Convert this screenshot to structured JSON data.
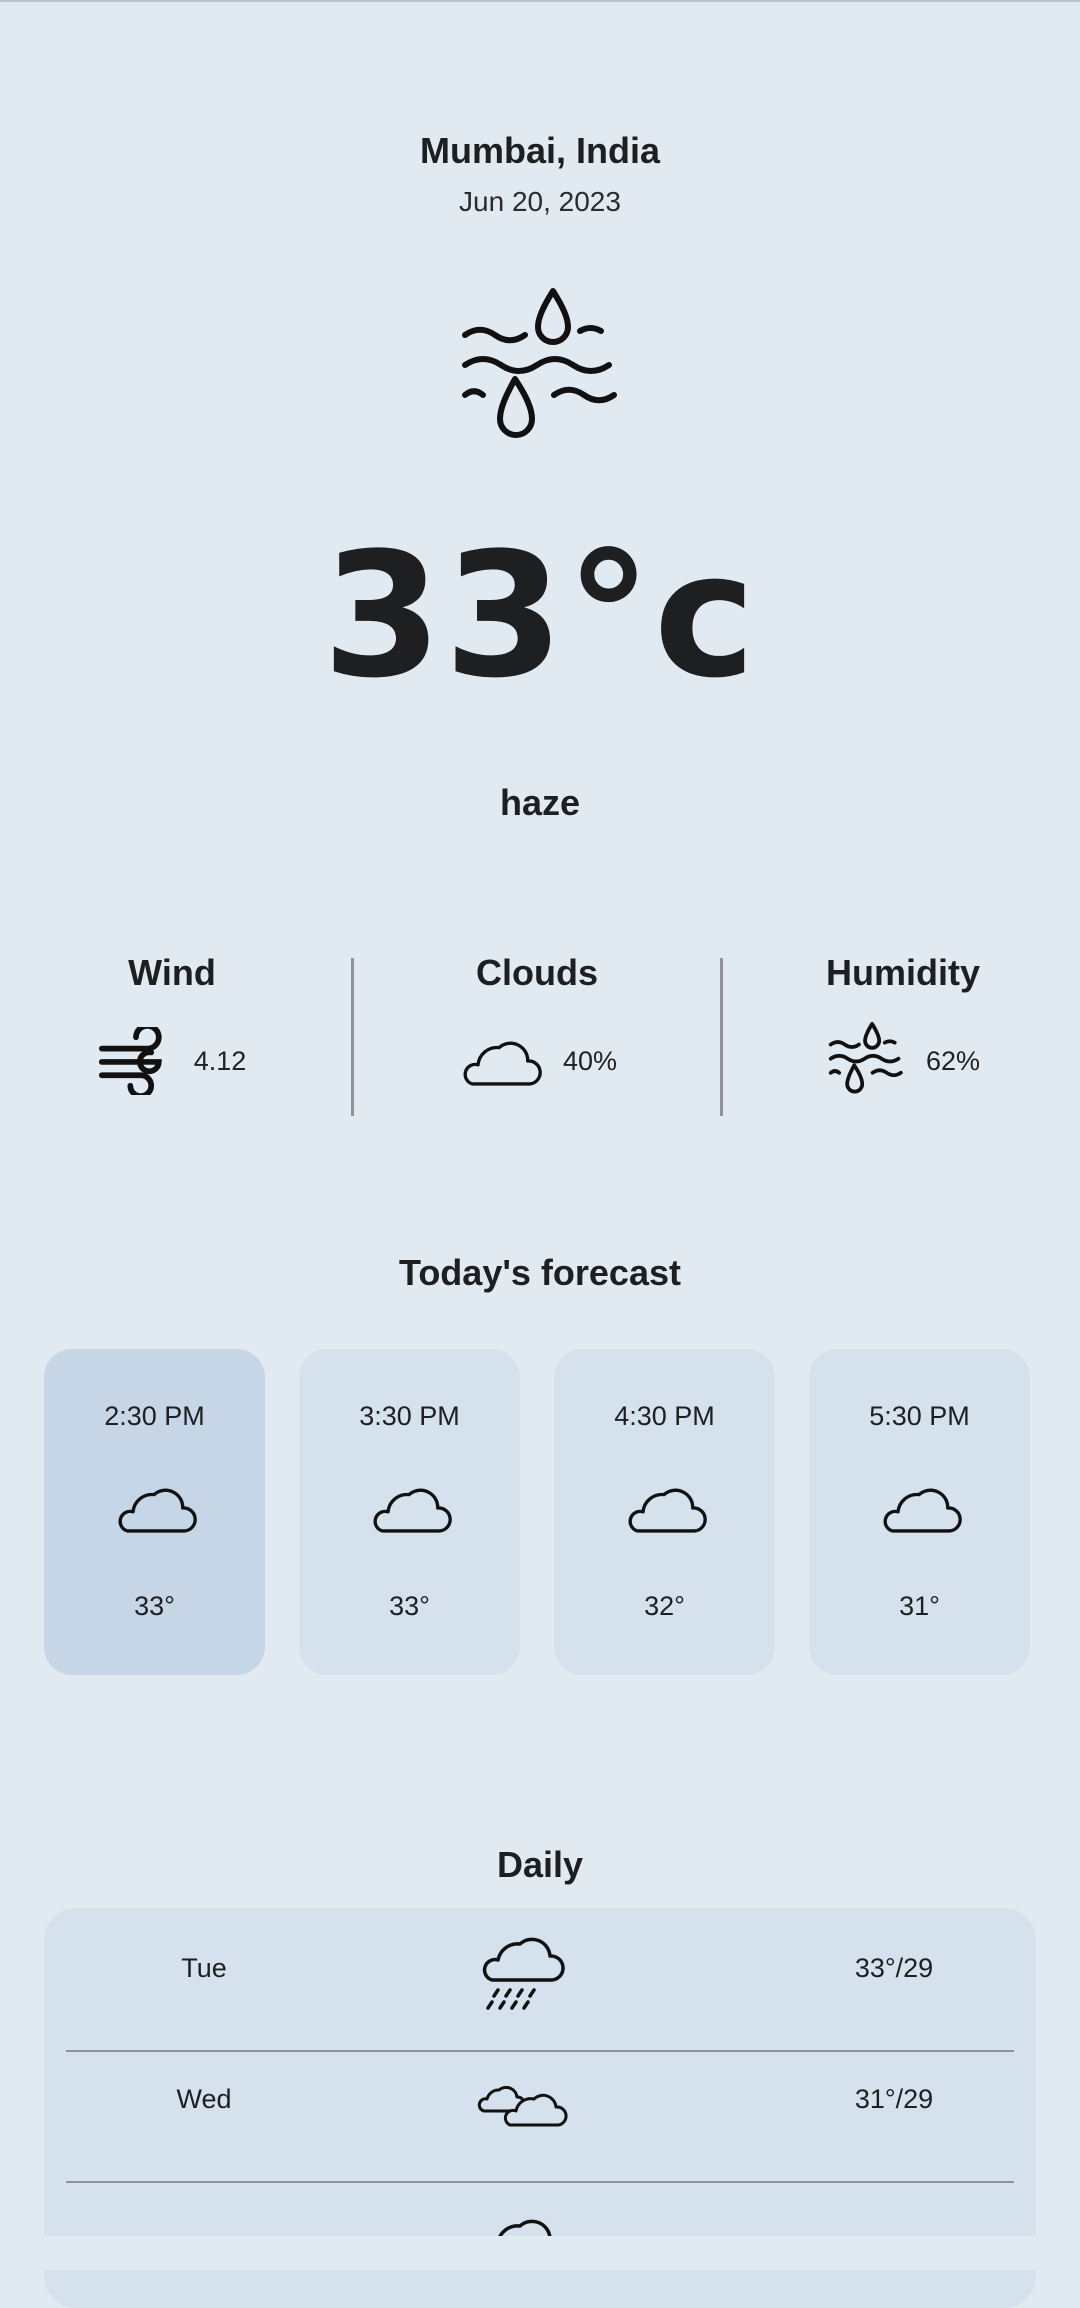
{
  "location": {
    "city": "Mumbai, India",
    "date": "Jun 20, 2023",
    "icon": "haze-icon"
  },
  "current": {
    "temperature": "33°c",
    "condition": "haze"
  },
  "stats": {
    "wind": {
      "title": "Wind",
      "value": "4.12",
      "icon": "wind-icon"
    },
    "clouds": {
      "title": "Clouds",
      "value": "40%",
      "icon": "cloud-icon"
    },
    "humidity": {
      "title": "Humidity",
      "value": "62%",
      "icon": "haze-icon"
    }
  },
  "forecast": {
    "title": "Today's forecast",
    "items": [
      {
        "time": "2:30 PM",
        "temp": "33°",
        "icon": "cloud-icon",
        "selected": true
      },
      {
        "time": "3:30 PM",
        "temp": "33°",
        "icon": "cloud-icon",
        "selected": false
      },
      {
        "time": "4:30 PM",
        "temp": "32°",
        "icon": "cloud-icon",
        "selected": false
      },
      {
        "time": "5:30 PM",
        "temp": "31°",
        "icon": "cloud-icon",
        "selected": false
      }
    ]
  },
  "daily": {
    "title": "Daily",
    "items": [
      {
        "day": "Tue",
        "temp": "33°/29",
        "icon": "rain-cloud-icon"
      },
      {
        "day": "Wed",
        "temp": "31°/29",
        "icon": "two-clouds-icon"
      },
      {
        "day": "",
        "temp": "",
        "icon": "cloud-icon"
      }
    ]
  },
  "colors": {
    "background": "#e2eaf1",
    "card": "#d5e1ec",
    "card_active": "#c6d6e6",
    "text": "#1e1f21",
    "divider": "#8e949a"
  }
}
